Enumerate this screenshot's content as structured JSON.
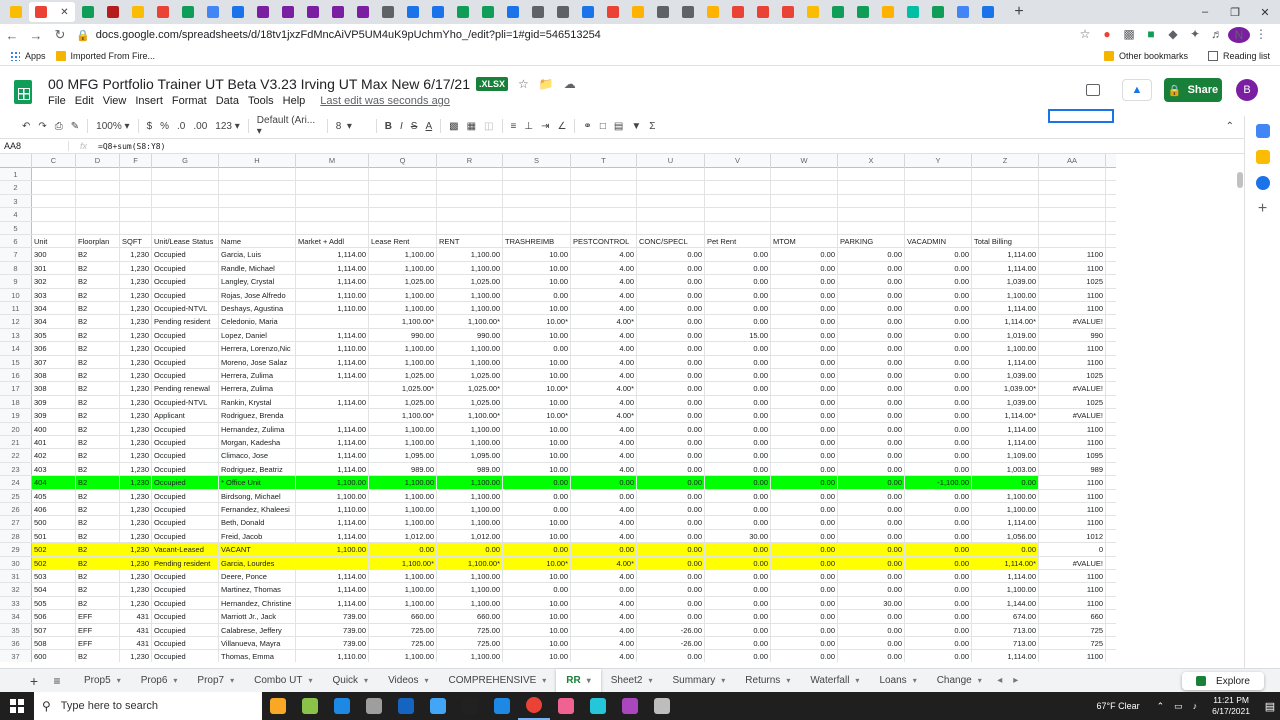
{
  "browser": {
    "url": "docs.google.com/spreadsheets/d/18tv1jxzFdMncAiVP5UM4uK9pUchmYho_/edit?pli=1#gid=546513254",
    "tab_colors": [
      "#fbbc04",
      "#ea4335",
      "#0f9d58",
      "#b71c1c",
      "#fbbc04",
      "#ea4335",
      "#0f9d58",
      "#4285f4",
      "#1a73e8",
      "#7b1fa2",
      "#7b1fa2",
      "#7b1fa2",
      "#7b1fa2",
      "#7b1fa2",
      "#5f6368",
      "#1a73e8",
      "#1a73e8",
      "#0f9d58",
      "#0f9d58",
      "#1a73e8",
      "#5f6368",
      "#5f6368",
      "#1a73e8",
      "#ea4335",
      "#ffb300",
      "#5f6368",
      "#5f6368",
      "#ffb300",
      "#ea4335",
      "#ea4335",
      "#ea4335",
      "#fbbc04",
      "#0f9d58",
      "#0f9d58",
      "#ffb300",
      "#00bfa5",
      "#0f9d58",
      "#4285f4",
      "#1a73e8"
    ],
    "bookmarks": {
      "apps": "Apps",
      "imported": "Imported From Fire...",
      "other": "Other bookmarks",
      "reading": "Reading list"
    },
    "profile_initial": "N"
  },
  "doc": {
    "title": "00 MFG Portfolio Trainer UT Beta V3.23 Irving UT Max New 6/17/21",
    "badge": ".XLSX",
    "menus": [
      "File",
      "Edit",
      "View",
      "Insert",
      "Format",
      "Data",
      "Tools",
      "Help"
    ],
    "last_edit": "Last edit was seconds ago",
    "share_label": "Share",
    "account_initial": "B"
  },
  "toolbar": {
    "zoom": "100%",
    "currency": "$",
    "percent": "%",
    "dec_less": ".0",
    "dec_more": ".00",
    "more_formats": "123",
    "font": "Default (Ari...",
    "size": "8",
    "bold": "B",
    "italic": "I",
    "strike": "S",
    "textcolor": "A"
  },
  "formula_bar": {
    "cell": "AA8",
    "fx": "fx",
    "formula": "=Q8+sum(S8:Y8)"
  },
  "grid": {
    "columns": [
      {
        "id": "C",
        "w": 44
      },
      {
        "id": "D",
        "w": 44
      },
      {
        "id": "F",
        "w": 32
      },
      {
        "id": "G",
        "w": 67
      },
      {
        "id": "H",
        "w": 77
      },
      {
        "id": "M",
        "w": 73
      },
      {
        "id": "Q",
        "w": 68
      },
      {
        "id": "R",
        "w": 66
      },
      {
        "id": "S",
        "w": 68
      },
      {
        "id": "T",
        "w": 66
      },
      {
        "id": "U",
        "w": 68
      },
      {
        "id": "V",
        "w": 66
      },
      {
        "id": "W",
        "w": 67
      },
      {
        "id": "X",
        "w": 67
      },
      {
        "id": "Y",
        "w": 67
      },
      {
        "id": "Z",
        "w": 67
      },
      {
        "id": "AA",
        "w": 67
      }
    ],
    "rows": [
      {
        "n": "1",
        "cells": []
      },
      {
        "n": "2",
        "cells": []
      },
      {
        "n": "3",
        "cells": []
      },
      {
        "n": "4",
        "cells": []
      },
      {
        "n": "5",
        "cells": []
      },
      {
        "n": "6",
        "cells": [
          "Unit",
          "Floorplan",
          "SQFT",
          "Unit/Lease Status",
          "Name",
          "Market + Addl",
          "Lease Rent",
          "RENT",
          "TRASHREIMB",
          "PESTCONTROL",
          "CONC/SPECL",
          "Pet Rent",
          "MTOM",
          "PARKING",
          "VACADMIN",
          "Total Billing",
          ""
        ]
      },
      {
        "n": "7",
        "cells": [
          "300",
          "B2",
          "1,230",
          "Occupied",
          "Garcia, Luis",
          "1,114.00",
          "1,100.00",
          "1,100.00",
          "10.00",
          "4.00",
          "0.00",
          "0.00",
          "0.00",
          "0.00",
          "0.00",
          "1,114.00",
          "1100"
        ]
      },
      {
        "n": "8",
        "cells": [
          "301",
          "B2",
          "1,230",
          "Occupied",
          "Randle, Michael",
          "1,114.00",
          "1,100.00",
          "1,100.00",
          "10.00",
          "4.00",
          "0.00",
          "0.00",
          "0.00",
          "0.00",
          "0.00",
          "1,114.00",
          "1100"
        ]
      },
      {
        "n": "9",
        "cells": [
          "302",
          "B2",
          "1,230",
          "Occupied",
          "Langley, Crystal",
          "1,114.00",
          "1,025.00",
          "1,025.00",
          "10.00",
          "4.00",
          "0.00",
          "0.00",
          "0.00",
          "0.00",
          "0.00",
          "1,039.00",
          "1025"
        ]
      },
      {
        "n": "10",
        "cells": [
          "303",
          "B2",
          "1,230",
          "Occupied",
          "Rojas, Jose Alfredo",
          "1,110.00",
          "1,100.00",
          "1,100.00",
          "0.00",
          "4.00",
          "0.00",
          "0.00",
          "0.00",
          "0.00",
          "0.00",
          "1,100.00",
          "1100"
        ]
      },
      {
        "n": "11",
        "cells": [
          "304",
          "B2",
          "1,230",
          "Occupied-NTVL",
          "Deshays, Agustina",
          "1,110.00",
          "1,100.00",
          "1,100.00",
          "10.00",
          "4.00",
          "0.00",
          "0.00",
          "0.00",
          "0.00",
          "0.00",
          "1,114.00",
          "1100"
        ]
      },
      {
        "n": "12",
        "cells": [
          "304",
          "B2",
          "1,230",
          "Pending resident",
          "Celedonio, Maria",
          "",
          "1,100.00*",
          "1,100.00*",
          "10.00*",
          "4.00*",
          "0.00",
          "0.00",
          "0.00",
          "0.00",
          "0.00",
          "1,114.00*",
          "#VALUE!"
        ]
      },
      {
        "n": "13",
        "cells": [
          "305",
          "B2",
          "1,230",
          "Occupied",
          "Lopez, Daniel",
          "1,114.00",
          "990.00",
          "990.00",
          "10.00",
          "4.00",
          "0.00",
          "15.00",
          "0.00",
          "0.00",
          "0.00",
          "1,019.00",
          "990"
        ]
      },
      {
        "n": "14",
        "cells": [
          "306",
          "B2",
          "1,230",
          "Occupied",
          "Herrera, Lorenzo,Nic",
          "1,110.00",
          "1,100.00",
          "1,100.00",
          "0.00",
          "4.00",
          "0.00",
          "0.00",
          "0.00",
          "0.00",
          "0.00",
          "1,100.00",
          "1100"
        ]
      },
      {
        "n": "15",
        "cells": [
          "307",
          "B2",
          "1,230",
          "Occupied",
          "Moreno, Jose  Salaz",
          "1,114.00",
          "1,100.00",
          "1,100.00",
          "10.00",
          "4.00",
          "0.00",
          "0.00",
          "0.00",
          "0.00",
          "0.00",
          "1,114.00",
          "1100"
        ]
      },
      {
        "n": "16",
        "cells": [
          "308",
          "B2",
          "1,230",
          "Occupied",
          "Herrera, Zulima",
          "1,114.00",
          "1,025.00",
          "1,025.00",
          "10.00",
          "4.00",
          "0.00",
          "0.00",
          "0.00",
          "0.00",
          "0.00",
          "1,039.00",
          "1025"
        ]
      },
      {
        "n": "17",
        "cells": [
          "308",
          "B2",
          "1,230",
          "Pending renewal",
          "Herrera, Zulima",
          "",
          "1,025.00*",
          "1,025.00*",
          "10.00*",
          "4.00*",
          "0.00",
          "0.00",
          "0.00",
          "0.00",
          "0.00",
          "1,039.00*",
          "#VALUE!"
        ]
      },
      {
        "n": "18",
        "cells": [
          "309",
          "B2",
          "1,230",
          "Occupied-NTVL",
          "Rankin, Krystal",
          "1,114.00",
          "1,025.00",
          "1,025.00",
          "10.00",
          "4.00",
          "0.00",
          "0.00",
          "0.00",
          "0.00",
          "0.00",
          "1,039.00",
          "1025"
        ]
      },
      {
        "n": "19",
        "cells": [
          "309",
          "B2",
          "1,230",
          "Applicant",
          "Rodriguez, Brenda",
          "",
          "1,100.00*",
          "1,100.00*",
          "10.00*",
          "4.00*",
          "0.00",
          "0.00",
          "0.00",
          "0.00",
          "0.00",
          "1,114.00*",
          "#VALUE!"
        ]
      },
      {
        "n": "20",
        "cells": [
          "400",
          "B2",
          "1,230",
          "Occupied",
          "Hernandez, Zulima",
          "1,114.00",
          "1,100.00",
          "1,100.00",
          "10.00",
          "4.00",
          "0.00",
          "0.00",
          "0.00",
          "0.00",
          "0.00",
          "1,114.00",
          "1100"
        ]
      },
      {
        "n": "21",
        "cells": [
          "401",
          "B2",
          "1,230",
          "Occupied",
          "Morgan, Kadesha",
          "1,114.00",
          "1,100.00",
          "1,100.00",
          "10.00",
          "4.00",
          "0.00",
          "0.00",
          "0.00",
          "0.00",
          "0.00",
          "1,114.00",
          "1100"
        ]
      },
      {
        "n": "22",
        "cells": [
          "402",
          "B2",
          "1,230",
          "Occupied",
          "Climaco, Jose",
          "1,114.00",
          "1,095.00",
          "1,095.00",
          "10.00",
          "4.00",
          "0.00",
          "0.00",
          "0.00",
          "0.00",
          "0.00",
          "1,109.00",
          "1095"
        ]
      },
      {
        "n": "23",
        "cells": [
          "403",
          "B2",
          "1,230",
          "Occupied",
          "Rodriguez, Beatriz",
          "1,114.00",
          "989.00",
          "989.00",
          "10.00",
          "4.00",
          "0.00",
          "0.00",
          "0.00",
          "0.00",
          "0.00",
          "1,003.00",
          "989"
        ]
      },
      {
        "n": "24",
        "hl": "green",
        "cells": [
          "404",
          "B2",
          "1,230",
          "Occupied",
          "* Office Unit",
          "1,100.00",
          "1,100.00",
          "1,100.00",
          "0.00",
          "0.00",
          "0.00",
          "0.00",
          "0.00",
          "0.00",
          "-1,100.00",
          "0.00",
          "1100"
        ]
      },
      {
        "n": "25",
        "cells": [
          "405",
          "B2",
          "1,230",
          "Occupied",
          "Birdsong, Michael",
          "1,100.00",
          "1,100.00",
          "1,100.00",
          "0.00",
          "0.00",
          "0.00",
          "0.00",
          "0.00",
          "0.00",
          "0.00",
          "1,100.00",
          "1100"
        ]
      },
      {
        "n": "26",
        "cells": [
          "406",
          "B2",
          "1,230",
          "Occupied",
          "Fernandez, Khaleesi",
          "1,110.00",
          "1,100.00",
          "1,100.00",
          "0.00",
          "4.00",
          "0.00",
          "0.00",
          "0.00",
          "0.00",
          "0.00",
          "1,100.00",
          "1100"
        ]
      },
      {
        "n": "27",
        "cells": [
          "500",
          "B2",
          "1,230",
          "Occupied",
          "Beth, Donald",
          "1,114.00",
          "1,100.00",
          "1,100.00",
          "10.00",
          "4.00",
          "0.00",
          "0.00",
          "0.00",
          "0.00",
          "0.00",
          "1,114.00",
          "1100"
        ]
      },
      {
        "n": "28",
        "cells": [
          "501",
          "B2",
          "1,230",
          "Occupied",
          "Freid, Jacob",
          "1,114.00",
          "1,012.00",
          "1,012.00",
          "10.00",
          "4.00",
          "0.00",
          "30.00",
          "0.00",
          "0.00",
          "0.00",
          "1,056.00",
          "1012"
        ]
      },
      {
        "n": "29",
        "hl": "yellow",
        "cells": [
          "502",
          "B2",
          "1,230",
          "Vacant-Leased",
          "VACANT",
          "1,100.00",
          "0.00",
          "0.00",
          "0.00",
          "0.00",
          "0.00",
          "0.00",
          "0.00",
          "0.00",
          "0.00",
          "0.00",
          "0"
        ]
      },
      {
        "n": "30",
        "hl": "yellow",
        "cells": [
          "502",
          "B2",
          "1,230",
          "Pending resident",
          "Garcia, Lourdes",
          "",
          "1,100.00*",
          "1,100.00*",
          "10.00*",
          "4.00*",
          "0.00",
          "0.00",
          "0.00",
          "0.00",
          "0.00",
          "1,114.00*",
          "#VALUE!"
        ]
      },
      {
        "n": "31",
        "cells": [
          "503",
          "B2",
          "1,230",
          "Occupied",
          "Deere, Ponce",
          "1,114.00",
          "1,100.00",
          "1,100.00",
          "10.00",
          "4.00",
          "0.00",
          "0.00",
          "0.00",
          "0.00",
          "0.00",
          "1,114.00",
          "1100"
        ]
      },
      {
        "n": "32",
        "cells": [
          "504",
          "B2",
          "1,230",
          "Occupied",
          "Martinez, Thomas",
          "1,114.00",
          "1,100.00",
          "1,100.00",
          "0.00",
          "0.00",
          "0.00",
          "0.00",
          "0.00",
          "0.00",
          "0.00",
          "1,100.00",
          "1100"
        ]
      },
      {
        "n": "33",
        "cells": [
          "505",
          "B2",
          "1,230",
          "Occupied",
          "Hernandez, Christine",
          "1,114.00",
          "1,100.00",
          "1,100.00",
          "10.00",
          "4.00",
          "0.00",
          "0.00",
          "0.00",
          "30.00",
          "0.00",
          "1,144.00",
          "1100"
        ]
      },
      {
        "n": "34",
        "cells": [
          "506",
          "EFF",
          "431",
          "Occupied",
          "Marriott Jr., Jack",
          "739.00",
          "660.00",
          "660.00",
          "10.00",
          "4.00",
          "0.00",
          "0.00",
          "0.00",
          "0.00",
          "0.00",
          "674.00",
          "660"
        ]
      },
      {
        "n": "35",
        "cells": [
          "507",
          "EFF",
          "431",
          "Occupied",
          "Calabrese, Jeffery",
          "739.00",
          "725.00",
          "725.00",
          "10.00",
          "4.00",
          "-26.00",
          "0.00",
          "0.00",
          "0.00",
          "0.00",
          "713.00",
          "725"
        ]
      },
      {
        "n": "36",
        "cells": [
          "508",
          "EFF",
          "431",
          "Occupied",
          "Villanueva, Mayra",
          "739.00",
          "725.00",
          "725.00",
          "10.00",
          "4.00",
          "-26.00",
          "0.00",
          "0.00",
          "0.00",
          "0.00",
          "713.00",
          "725"
        ]
      },
      {
        "n": "37",
        "cells": [
          "600",
          "B2",
          "1,230",
          "Occupied",
          "Thomas, Emma",
          "1,110.00",
          "1,100.00",
          "1,100.00",
          "10.00",
          "4.00",
          "0.00",
          "0.00",
          "0.00",
          "0.00",
          "0.00",
          "1,114.00",
          "1100"
        ]
      }
    ]
  },
  "sheets": [
    {
      "label": "Prop5",
      "active": false
    },
    {
      "label": "Prop6",
      "active": false
    },
    {
      "label": "Prop7",
      "active": false
    },
    {
      "label": "Combo UT",
      "active": false
    },
    {
      "label": "Quick",
      "active": false
    },
    {
      "label": "Videos",
      "active": false
    },
    {
      "label": "COMPREHENSIVE",
      "active": false
    },
    {
      "label": "RR",
      "active": true
    },
    {
      "label": "Sheet2",
      "active": false
    },
    {
      "label": "Summary",
      "active": false
    },
    {
      "label": "Returns",
      "active": false
    },
    {
      "label": "Waterfall",
      "active": false
    },
    {
      "label": "Loans",
      "active": false
    },
    {
      "label": "Change",
      "active": false
    }
  ],
  "explore_label": "Explore",
  "taskbar": {
    "search_placeholder": "Type here to search",
    "apps": [
      "#f9a825",
      "#8bc34a",
      "#1e88e5",
      "#9e9e9e",
      "#1565c0",
      "#42a5f5",
      "#212121",
      "#1e88e5",
      "#ea4335",
      "#f06292",
      "#26c6da",
      "#ab47bc",
      "#bdbdbd"
    ],
    "weather": "67°F  Clear",
    "time": "11:21 PM",
    "date": "6/17/2021"
  }
}
